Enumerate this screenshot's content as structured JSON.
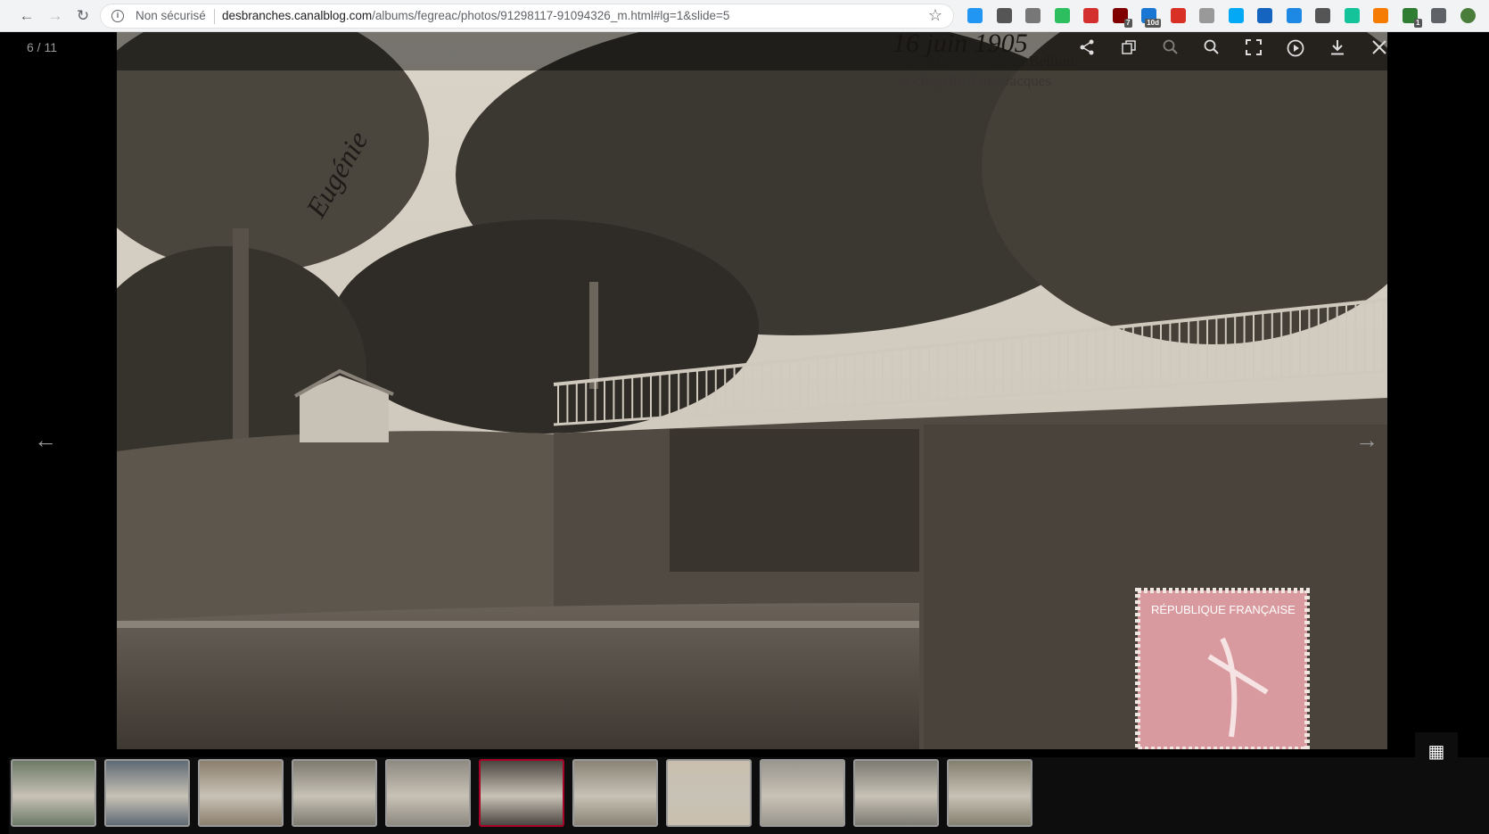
{
  "browser": {
    "insecure_label": "Non sécurisé",
    "url_domain": "desbranches.canalblog.com",
    "url_path": "/albums/fegreac/photos/91298117-91094326_m.html#lg=1&slide=5",
    "extensions": [
      {
        "name": "ext-icon-1",
        "color": "#2196f3",
        "badge": ""
      },
      {
        "name": "pinterest-icon",
        "color": "#555",
        "badge": ""
      },
      {
        "name": "camera-icon",
        "color": "#777",
        "badge": ""
      },
      {
        "name": "evernote-icon",
        "color": "#2dbe60",
        "badge": ""
      },
      {
        "name": "ext-icon-5",
        "color": "#d32f2f",
        "badge": ""
      },
      {
        "name": "ublock-icon",
        "color": "#800000",
        "badge": "7"
      },
      {
        "name": "calendar-icon",
        "color": "#1976d2",
        "badge": "10d"
      },
      {
        "name": "gmail-icon",
        "color": "#d93025",
        "badge": ""
      },
      {
        "name": "copy-icon",
        "color": "#999",
        "badge": ""
      },
      {
        "name": "ext-icon-10",
        "color": "#03a9f4",
        "badge": ""
      },
      {
        "name": "reader-icon",
        "color": "#1565c0",
        "badge": ""
      },
      {
        "name": "star-badge-icon",
        "color": "#1e88e5",
        "badge": ""
      },
      {
        "name": "ext-icon-13",
        "color": "#555",
        "badge": ""
      },
      {
        "name": "grammarly-icon",
        "color": "#15c39a",
        "badge": ""
      },
      {
        "name": "ext-icon-15",
        "color": "#f57c00",
        "badge": ""
      },
      {
        "name": "analytics-icon",
        "color": "#2e7d32",
        "badge": "1"
      },
      {
        "name": "puzzle-icon",
        "color": "#5f6368",
        "badge": ""
      },
      {
        "name": "profile-avatar-icon",
        "color": "#4a7c3a",
        "badge": ""
      }
    ]
  },
  "viewer": {
    "counter": "6 / 11",
    "toolbar_icons": [
      "share-icon",
      "copy-icon",
      "zoom-out-icon",
      "zoom-in-icon",
      "fullscreen-icon",
      "autoplay-icon",
      "download-icon",
      "close-icon"
    ],
    "thumbnails_count": 11,
    "active_index": 5
  },
  "photo": {
    "handwriting_date": "16 juin 1905",
    "caption_line1": "FÉGRÉAC - Pont du Bellion",
    "caption_line2": "et chapelle Saint-Jacques",
    "signature": "Eugénie",
    "stamp_text": "RÉPUBLIQUE FRANÇAISE"
  }
}
